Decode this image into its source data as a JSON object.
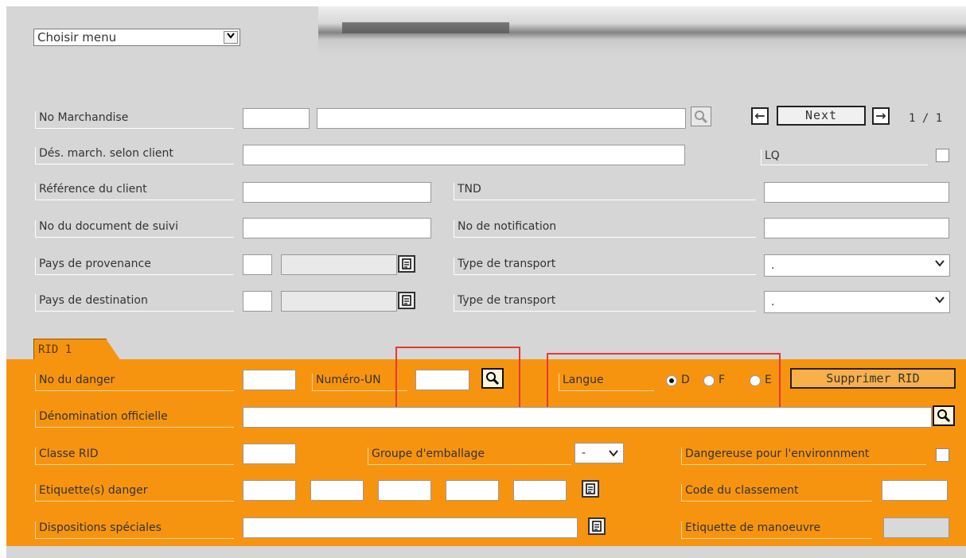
{
  "menu": {
    "select_value": "Choisir menu"
  },
  "top_form": {
    "no_marchandise": "No Marchandise",
    "des_march": "Dés. march. selon client",
    "ref_client": "Référence du client",
    "no_document": "No du document de suivi",
    "pays_provenance": "Pays de provenance",
    "pays_destination": "Pays de destination",
    "tnd": "TND",
    "no_notification": "No de notification",
    "type_transport_1": "Type de transport",
    "type_transport_2": "Type de transport",
    "type_transport_1_value": ".",
    "type_transport_2_value": ".",
    "lq": "LQ"
  },
  "nav": {
    "next_label": "Next",
    "prev_glyph": "←",
    "next_glyph": "→",
    "pager": "1 / 1"
  },
  "tab": {
    "label": "RID 1"
  },
  "rid": {
    "no_danger": "No du danger",
    "numero_un": "Numéro-UN",
    "langue": "Langue",
    "radio_d": "D",
    "radio_f": "F",
    "radio_e": "E",
    "supprimer": "Supprimer RID",
    "denomination": "Dénomination officielle",
    "classe": "Classe RID",
    "groupe": "Groupe d'emballage",
    "groupe_value": "-",
    "dangereuse": "Dangereuse pour l'environnment",
    "etiquettes": "Etiquette(s) danger",
    "code_classement": "Code du classement",
    "dispositions": "Dispositions spéciales",
    "etiquette_manoeuvre": "Etiquette de manoeuvre",
    "selected_language": "D"
  },
  "colors": {
    "panel_bg": "#d6d6d6",
    "rid_bg": "#f7940f",
    "highlight": "#e53935"
  },
  "icons": [
    "chevron-down-icon",
    "search-icon",
    "document-icon",
    "arrow-left-icon",
    "arrow-right-icon"
  ]
}
